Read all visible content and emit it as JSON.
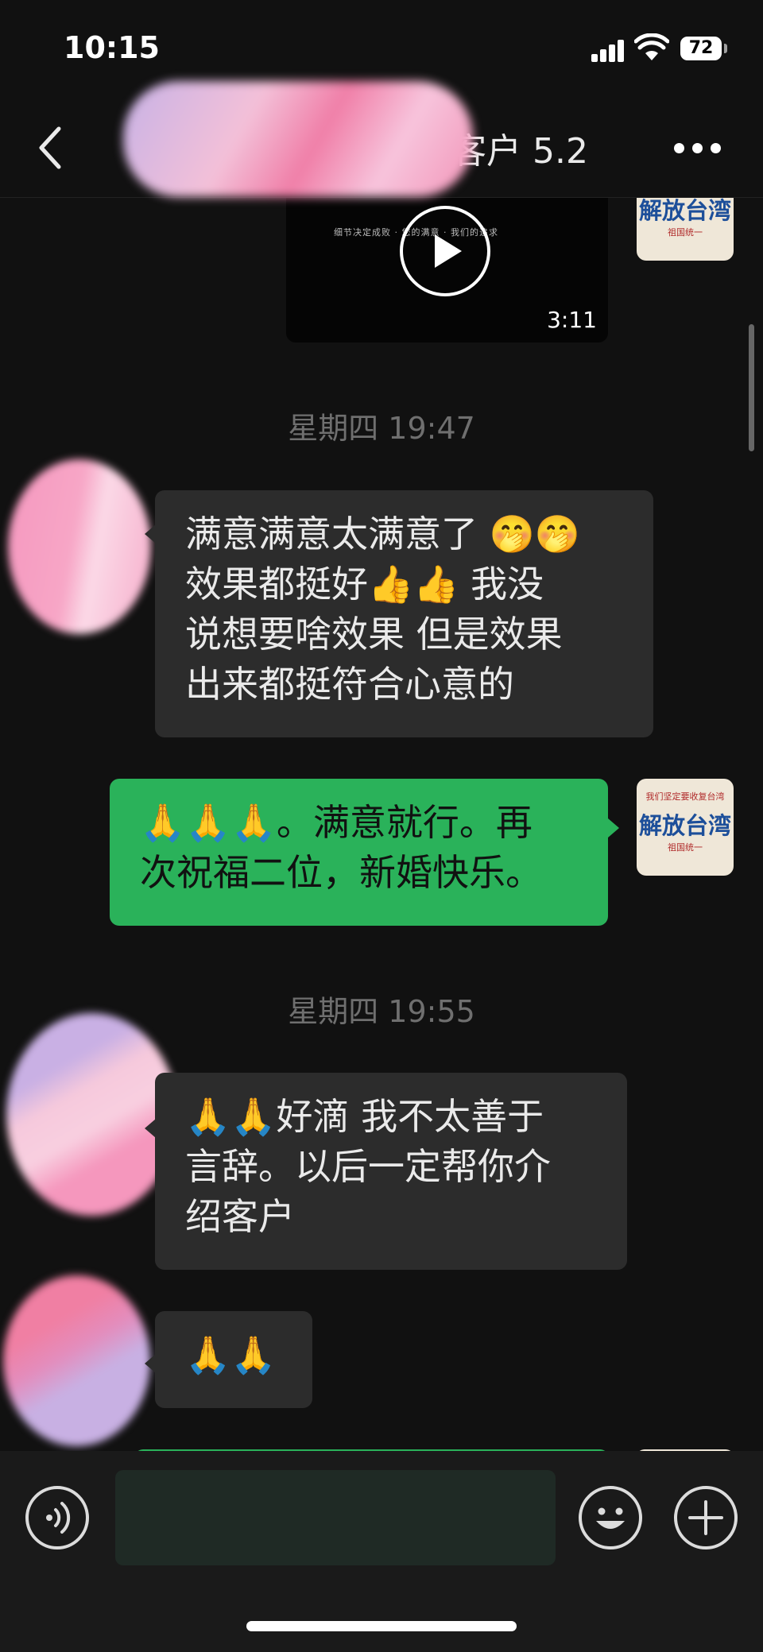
{
  "status_bar": {
    "time": "10:15",
    "battery": "72"
  },
  "nav": {
    "title": "客户 5.2"
  },
  "video": {
    "duration": "3:11",
    "caption": "细节决定成败 · 您的满意 · 我们的追求"
  },
  "avatar_me": {
    "top": "我们坚定要收复台湾",
    "main": "解放台湾",
    "sub": "祖国统一"
  },
  "messages": {
    "ts1": "星期四 19:47",
    "m1": "满意满意太满意了 🤭🤭\n效果都挺好👍👍 我没\n说想要啥效果 但是效果\n出来都挺符合心意的",
    "m2": "🙏🙏🙏。满意就行。再\n次祝福二位，新婚快乐。",
    "ts2": "星期四 19:55",
    "m3": "🙏🙏好滴 我不太善于\n言辞。以后一定帮你介\n绍客户",
    "m4": "🙏🙏"
  },
  "input": {
    "placeholder": ""
  },
  "colors": {
    "background": "#111111",
    "bubble_in": "#2c2c2c",
    "bubble_out": "#2ab25a",
    "avatar_text": "#1d4f9a"
  }
}
